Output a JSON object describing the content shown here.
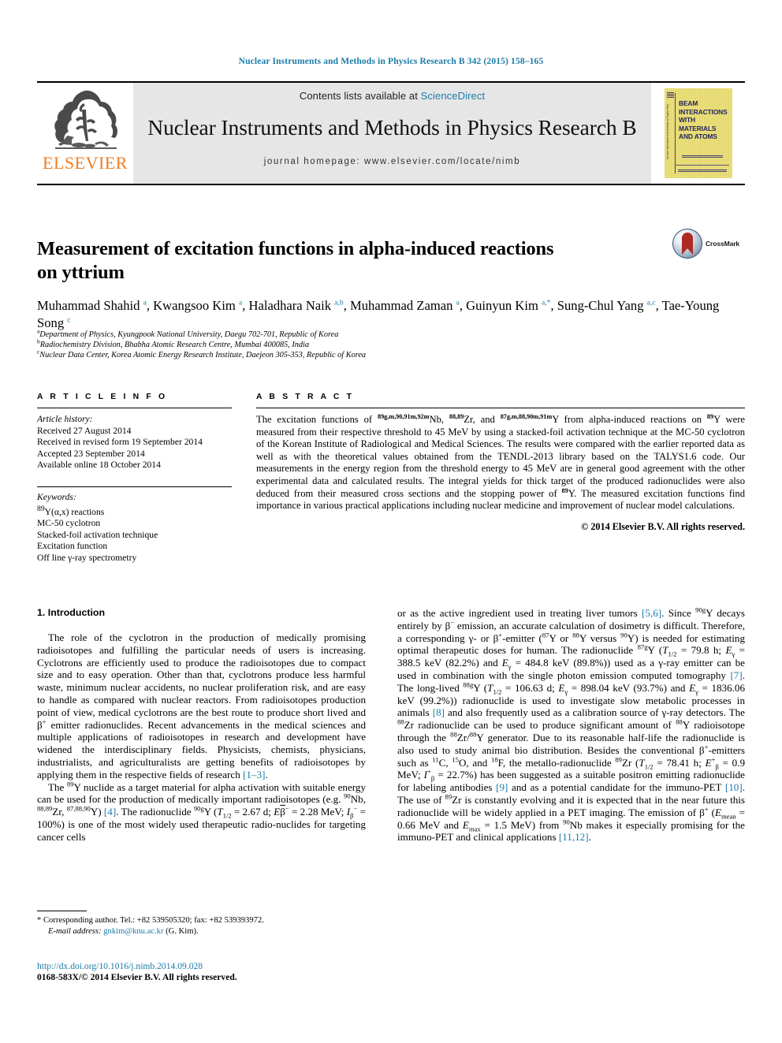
{
  "running_head": "Nuclear Instruments and Methods in Physics Research B 342 (2015) 158–165",
  "masthead": {
    "publisher": "ELSEVIER",
    "contents_prefix": "Contents lists available at ",
    "contents_link": "ScienceDirect",
    "journal_title": "Nuclear Instruments and Methods in Physics Research B",
    "homepage": "journal homepage: www.elsevier.com/locate/nimb",
    "cover_title": "BEAM INTERACTIONS WITH MATERIALS AND ATOMS",
    "cover_spine_text": "Nuclear Instruments and Methods in Physics Research B"
  },
  "article": {
    "title_line1": "Measurement of excitation functions in alpha-induced reactions",
    "title_line2": "on yttrium",
    "crossmark_label": "CrossMark",
    "authors_html": "Muhammad Shahid <sup>a</sup>, Kwangsoo Kim <sup>a</sup>, Haladhara Naik <sup>a,b</sup>, Muhammad Zaman <sup>a</sup>, Guinyun Kim <sup>a,*</sup>, Sung-Chul Yang <sup>a,c</sup>, Tae-Young Song <sup>c</sup>",
    "affiliations": [
      {
        "marker": "a",
        "text": "Department of Physics, Kyungpook National University, Daegu 702-701, Republic of Korea"
      },
      {
        "marker": "b",
        "text": "Radiochemistry Division, Bhabha Atomic Research Centre, Mumbai 400085, India"
      },
      {
        "marker": "c",
        "text": "Nuclear Data Center, Korea Atomic Energy Research Institute, Daejeon 305-353, Republic of Korea"
      }
    ]
  },
  "article_info": {
    "heading": "A R T I C L E  I N F O",
    "history_label": "Article history:",
    "history": [
      "Received 27 August 2014",
      "Received in revised form 19 September 2014",
      "Accepted 23 September 2014",
      "Available online 18 October 2014"
    ],
    "keywords_label": "Keywords:",
    "keywords_html": [
      "<sup>89</sup>Y(α,x) reactions",
      "MC-50 cyclotron",
      "Stacked-foil activation technique",
      "Excitation function",
      "Off line γ-ray spectrometry"
    ]
  },
  "abstract": {
    "heading": "A B S T R A C T",
    "text_html": "The excitation functions of <sup>89g,m,90,91m,92m</sup>Nb, <sup>88,89</sup>Zr, and <sup>87g,m,88,90m,91m</sup>Y from alpha-induced reactions on <sup>89</sup>Y were measured from their respective threshold to 45 MeV by using a stacked-foil activation technique at the MC-50 cyclotron of the Korean Institute of Radiological and Medical Sciences. The results were compared with the earlier reported data as well as with the theoretical values obtained from the TENDL-2013 library based on the TALYS1.6 code. Our measurements in the energy region from the threshold energy to 45 MeV are in general good agreement with the other experimental data and calculated results. The integral yields for thick target of the produced radionuclides were also deduced from their measured cross sections and the stopping power of <sup>89</sup>Y. The measured excitation functions find importance in various practical applications including nuclear medicine and improvement of nuclear model calculations.",
    "copyright": "© 2014 Elsevier B.V. All rights reserved."
  },
  "body": {
    "section_heading": "1. Introduction",
    "left_paragraph_1_html": "The role of the cyclotron in the production of medically promising radioisotopes and fulfilling the particular needs of users is increasing. Cyclotrons are efficiently used to produce the radioisotopes due to compact size and to easy operation. Other than that, cyclotrons produce less harmful waste, minimum nuclear accidents, no nuclear proliferation risk, and are easy to handle as compared with nuclear reactors. From radioisotopes production point of view, medical cyclotrons are the best route to produce short lived and β<sup>+</sup> emitter radionuclides. Recent advancements in the medical sciences and multiple applications of radioisotopes in research and development have widened the interdisciplinary fields. Physicists, chemists, physicians, industrialists, and agriculturalists are getting benefits of radioisotopes by applying them in the respective fields of research <span class=\"ref\">[1–3]</span>.",
    "left_paragraph_2_html": "The <sup>89</sup>Y nuclide as a target material for alpha activation with suitable energy can be used for the production of medically important radioisotopes (e.g. <sup>90</sup>Nb, <sup>88,89</sup>Zr, <sup>87,88,90</sup>Y) <span class=\"ref\">[4]</span>. The radionuclide <sup>90g</sup>Y (<span class=\"ital\">T</span><sub>1/2</sub> = 2.67 d; <span class=\"ital\">E</span><span style=\"text-decoration:overline\">&#x3b2;</span><sup>&#x2212;</sup> = 2.28 MeV; <span class=\"ital\">I</span><sub>β</sub><sup>−</sup> = 100%) is one of the most widely used therapeutic radio-nuclides for targeting cancer cells",
    "right_paragraph_html": "or as the active ingredient used in treating liver tumors <span class=\"ref\">[5,6]</span>. Since <sup>90g</sup>Y decays entirely by β<sup>−</sup> emission, an accurate calculation of dosimetry is difficult. Therefore, a corresponding γ- or β<sup>+</sup>-emitter (<sup>87</sup>Y or <sup>88</sup>Y versus <sup>90</sup>Y) is needed for estimating optimal therapeutic doses for human. The radionuclide <sup>87g</sup>Y (<span class=\"ital\">T</span><sub>1/2</sub> = 79.8 h; <span class=\"ital\">E</span><sub>γ</sub> = 388.5 keV (82.2%) and <span class=\"ital\">E</span><sub>γ</sub> = 484.8 keV (89.8%)) used as a γ-ray emitter can be used in combination with the single photon emission computed tomography <span class=\"ref\">[7]</span>. The long-lived <sup>88g</sup>Y (<span class=\"ital\">T</span><sub>1/2</sub> = 106.63 d; <span class=\"ital\">E</span><sub>γ</sub> = 898.04 keV (93.7%) and <span class=\"ital\">E</span><sub>γ</sub> = 1836.06 keV (99.2%)) radionuclide is used to investigate slow metabolic processes in animals <span class=\"ref\">[8]</span> and also frequently used as a calibration source of γ-ray detectors. The <sup>88</sup>Zr radionuclide can be used to produce significant amount of <sup>88</sup>Y radioisotope through the <sup>88</sup>Zr/<sup>88</sup>Y generator. Due to its reasonable half-life the radionuclide is also used to study animal bio distribution. Besides the conventional β<sup>+</sup>-emitters such as <sup>11</sup>C, <sup>15</sup>O, and <sup>18</sup>F, the metallo-radionuclide <sup>89</sup>Zr (<span class=\"ital\">T</span><sub>1/2</sub> = 78.41 h; <span class=\"ital\">E</span><sup>+</sup><sub>β</sub> = 0.9 MeV; <span class=\"ital\">I</span><sup>+</sup><sub>β</sub> = 22.7%) has been suggested as a suitable positron emitting radionuclide for labeling antibodies <span class=\"ref\">[9]</span> and as a potential candidate for the immuno-PET <span class=\"ref\">[10]</span>. The use of <sup>89</sup>Zr is constantly evolving and it is expected that in the near future this radionuclide will be widely applied in a PET imaging. The emission of β<sup>+</sup> (<span class=\"ital\">E</span><sub>mean</sub> = 0.66 MeV and <span class=\"ital\">E</span><sub>max</sub> = 1.5 MeV) from <sup>90</sup>Nb makes it especially promising for the immuno-PET and clinical applications <span class=\"ref\">[11,12]</span>."
  },
  "footer": {
    "corresponding_html": "* Corresponding author. Tel.: +82 539505320; fax: +82 539393972.",
    "email_label": "E-mail address:",
    "email": "gnkim@knu.ac.kr",
    "email_suffix": "(G. Kim).",
    "doi": "http://dx.doi.org/10.1016/j.nimb.2014.09.028",
    "issn": "0168-583X/© 2014 Elsevier B.V. All rights reserved."
  },
  "colors": {
    "link_blue": "#1a7ba8",
    "elsevier_orange": "#f07d20",
    "panel_grey": "#e6e6e6",
    "cover_yellow": "#efe27a",
    "cover_navy": "#23235e"
  }
}
